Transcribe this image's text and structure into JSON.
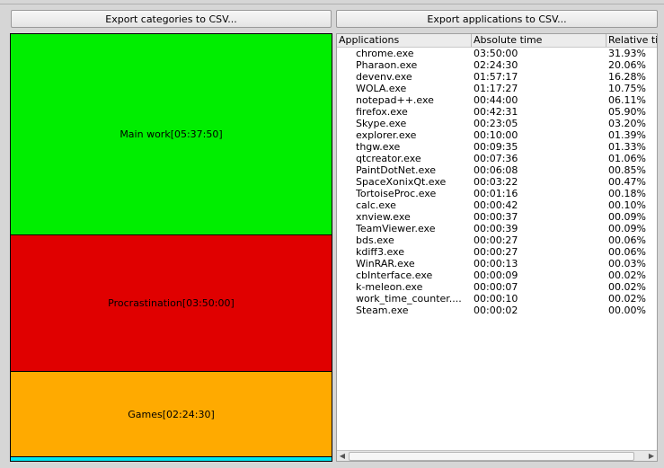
{
  "toolbar": {
    "export_categories_label": "Export categories to CSV...",
    "export_applications_label": "Export applications to CSV..."
  },
  "categories": [
    {
      "label": "Main work[05:37:50]",
      "color": "#00ee00"
    },
    {
      "label": "Procrastination[03:50:00]",
      "color": "#e00000"
    },
    {
      "label": "Games[02:24:30]",
      "color": "#ffaa00"
    },
    {
      "label": "",
      "color": "#00e5ee"
    }
  ],
  "table": {
    "headers": [
      "Applications",
      "Absolute time",
      "Relative ti"
    ],
    "rows": [
      [
        "chrome.exe",
        "03:50:00",
        "31.93%"
      ],
      [
        "Pharaon.exe",
        "02:24:30",
        "20.06%"
      ],
      [
        "devenv.exe",
        "01:57:17",
        "16.28%"
      ],
      [
        "WOLA.exe",
        "01:17:27",
        "10.75%"
      ],
      [
        "notepad++.exe",
        "00:44:00",
        "06.11%"
      ],
      [
        "firefox.exe",
        "00:42:31",
        "05.90%"
      ],
      [
        "Skype.exe",
        "00:23:05",
        "03.20%"
      ],
      [
        "explorer.exe",
        "00:10:00",
        "01.39%"
      ],
      [
        "thgw.exe",
        "00:09:35",
        "01.33%"
      ],
      [
        "qtcreator.exe",
        "00:07:36",
        "01.06%"
      ],
      [
        "PaintDotNet.exe",
        "00:06:08",
        "00.85%"
      ],
      [
        "SpaceXonixQt.exe",
        "00:03:22",
        "00.47%"
      ],
      [
        "TortoiseProc.exe",
        "00:01:16",
        "00.18%"
      ],
      [
        "calc.exe",
        "00:00:42",
        "00.10%"
      ],
      [
        "xnview.exe",
        "00:00:37",
        "00.09%"
      ],
      [
        "TeamViewer.exe",
        "00:00:39",
        "00.09%"
      ],
      [
        "bds.exe",
        "00:00:27",
        "00.06%"
      ],
      [
        "kdiff3.exe",
        "00:00:27",
        "00.06%"
      ],
      [
        "WinRAR.exe",
        "00:00:13",
        "00.03%"
      ],
      [
        "cbInterface.exe",
        "00:00:09",
        "00.02%"
      ],
      [
        "k-meleon.exe",
        "00:00:07",
        "00.02%"
      ],
      [
        "work_time_counter....",
        "00:00:10",
        "00.02%"
      ],
      [
        "Steam.exe",
        "00:00:02",
        "00.00%"
      ]
    ]
  },
  "scrollbar": {
    "left_icon": "arrow-left-icon",
    "right_icon": "arrow-right-icon"
  }
}
